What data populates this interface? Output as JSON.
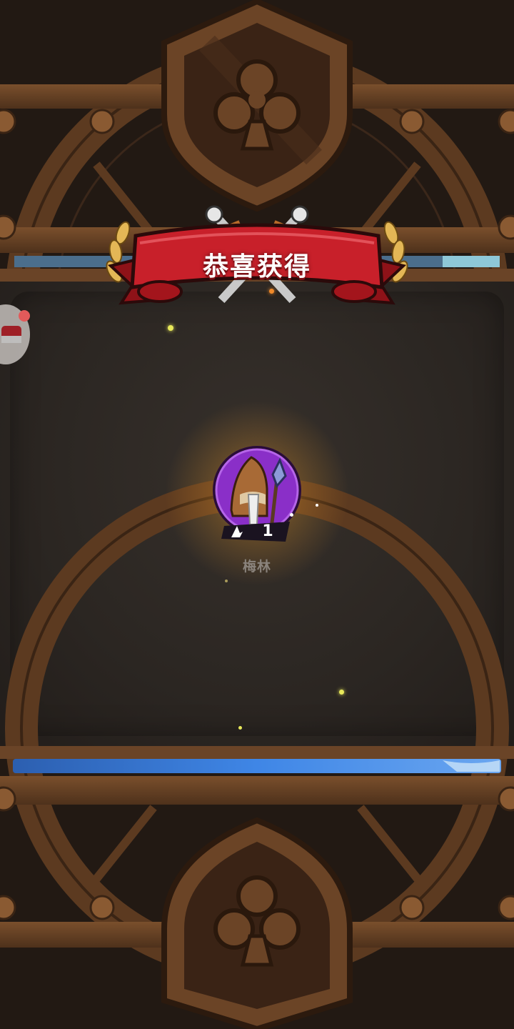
{
  "banner": {
    "title": "恭喜获得"
  },
  "reward": {
    "hero_name": "梅林",
    "count": "1"
  },
  "icons": {
    "top_emblem": "club-shield-icon",
    "bottom_emblem": "club-shield-icon",
    "crossed_swords": "crossed-swords-icon",
    "laurel": "laurel-icon",
    "hero_portrait": "merlin-wizard-portrait-icon",
    "item_type": "wizard-hat-icon",
    "side_button": "chest-icon"
  },
  "colors": {
    "ribbon_red": "#c8202a",
    "portrait_purple": "#8a2fc8",
    "wood": "#6b4426",
    "blue_bar": "#3b7ee0"
  }
}
